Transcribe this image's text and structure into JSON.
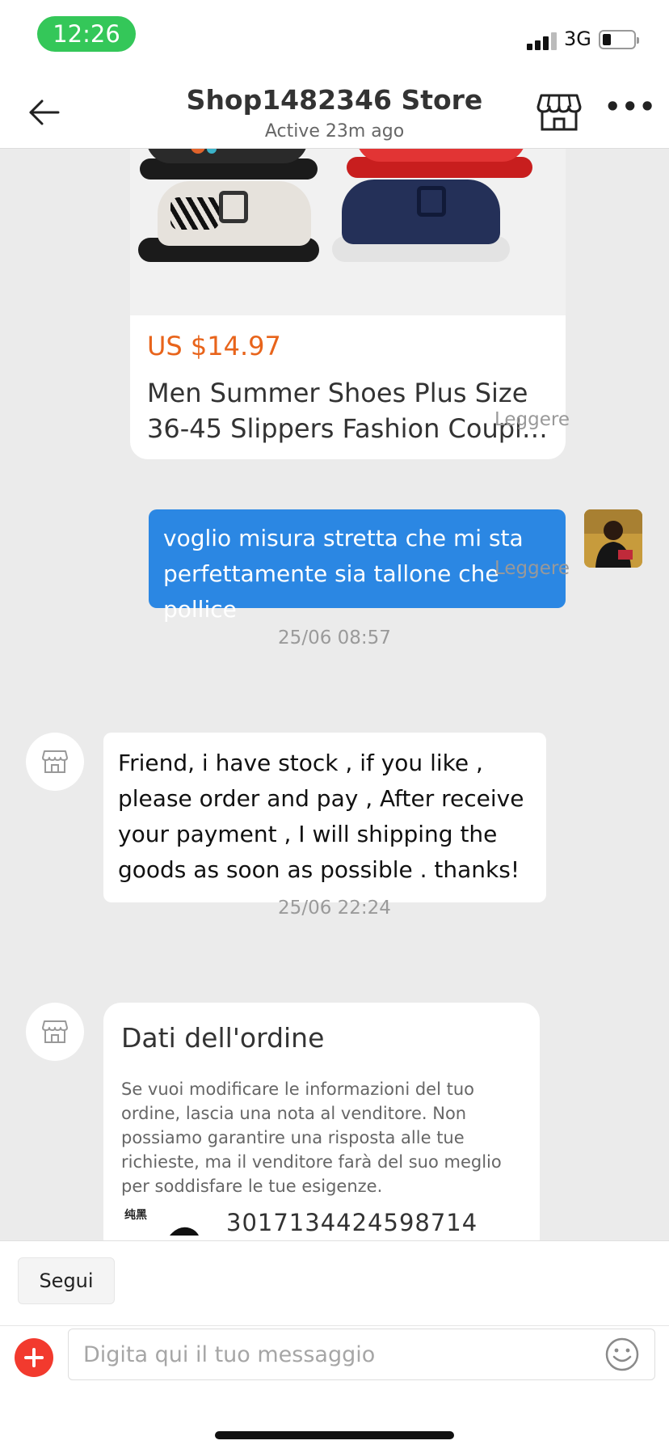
{
  "status_bar": {
    "time": "12:26",
    "network": "3G"
  },
  "header": {
    "title": "Shop1482346 Store",
    "subtitle": "Active 23m ago",
    "back_icon": "arrow-left-icon",
    "store_icon": "storefront-icon",
    "more_icon": "more-horizontal-icon",
    "more_label": "•••"
  },
  "messages": {
    "product_card": {
      "price": "US $14.97",
      "name_line1": "Men Summer Shoes Plus Size",
      "name_line2": "36-45 Slippers Fashion Couple..."
    },
    "read_label_1": "Leggere",
    "user_message": "voglio misura stretta che mi sta perfettamente sia tallone che pollice",
    "read_label_2": "Leggere",
    "timestamp_1": "25/06 08:57",
    "seller_message": "Friend, i have stock , if you like , please order and pay , After receive your payment , I will shipping the goods as soon as possible . thanks!",
    "timestamp_2": "25/06 22:24",
    "order_card": {
      "title": "Dati dell'ordine",
      "description": "Se vuoi modificare le informazioni del tuo ordine, lascia una nota al venditore. Non possiamo garantire una risposta alle tue richieste, ma il venditore farà del suo meglio per soddisfare le tue esigenze.",
      "thumb_label": "纯黑",
      "order_number": "3017134424598714"
    }
  },
  "bottom": {
    "follow_label": "Segui",
    "input_placeholder": "Digita qui il tuo messaggio",
    "plus_icon": "plus-circle-icon",
    "emoji_icon": "emoji-smile-icon"
  },
  "colors": {
    "accent_blue": "#2b87e3",
    "price_orange": "#e8641b",
    "plus_red": "#f23a2e",
    "status_green": "#34c759"
  }
}
